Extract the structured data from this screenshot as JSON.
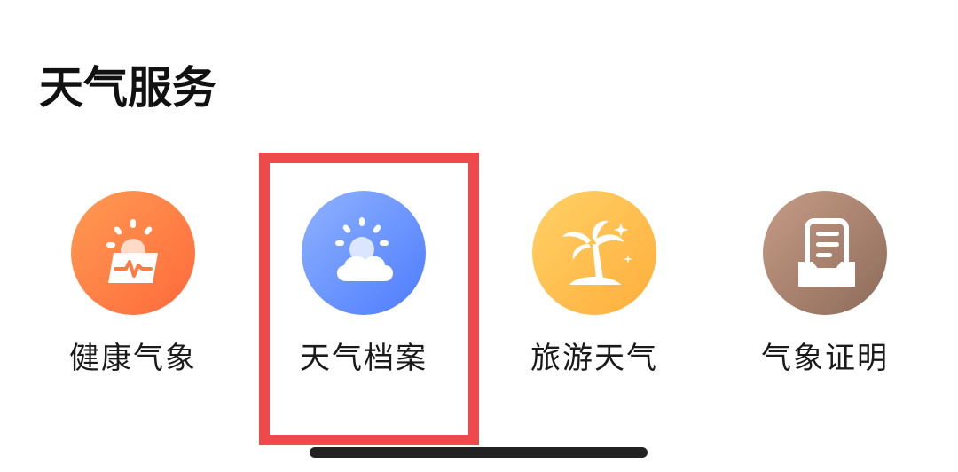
{
  "section": {
    "title": "天气服务"
  },
  "services": [
    {
      "label": "健康气象",
      "icon": "health-weather-icon",
      "gradient": [
        "#ff9a52",
        "#ff6a3c"
      ]
    },
    {
      "label": "天气档案",
      "icon": "weather-archive-icon",
      "gradient": [
        "#8fb2ff",
        "#4d7cff"
      ]
    },
    {
      "label": "旅游天气",
      "icon": "travel-weather-icon",
      "gradient": [
        "#ffd166",
        "#ffae3b"
      ]
    },
    {
      "label": "气象证明",
      "icon": "weather-certificate-icon",
      "gradient": [
        "#c69c86",
        "#8d6b5a"
      ]
    }
  ],
  "highlight": {
    "color": "#f0494c",
    "target": "天气档案"
  }
}
